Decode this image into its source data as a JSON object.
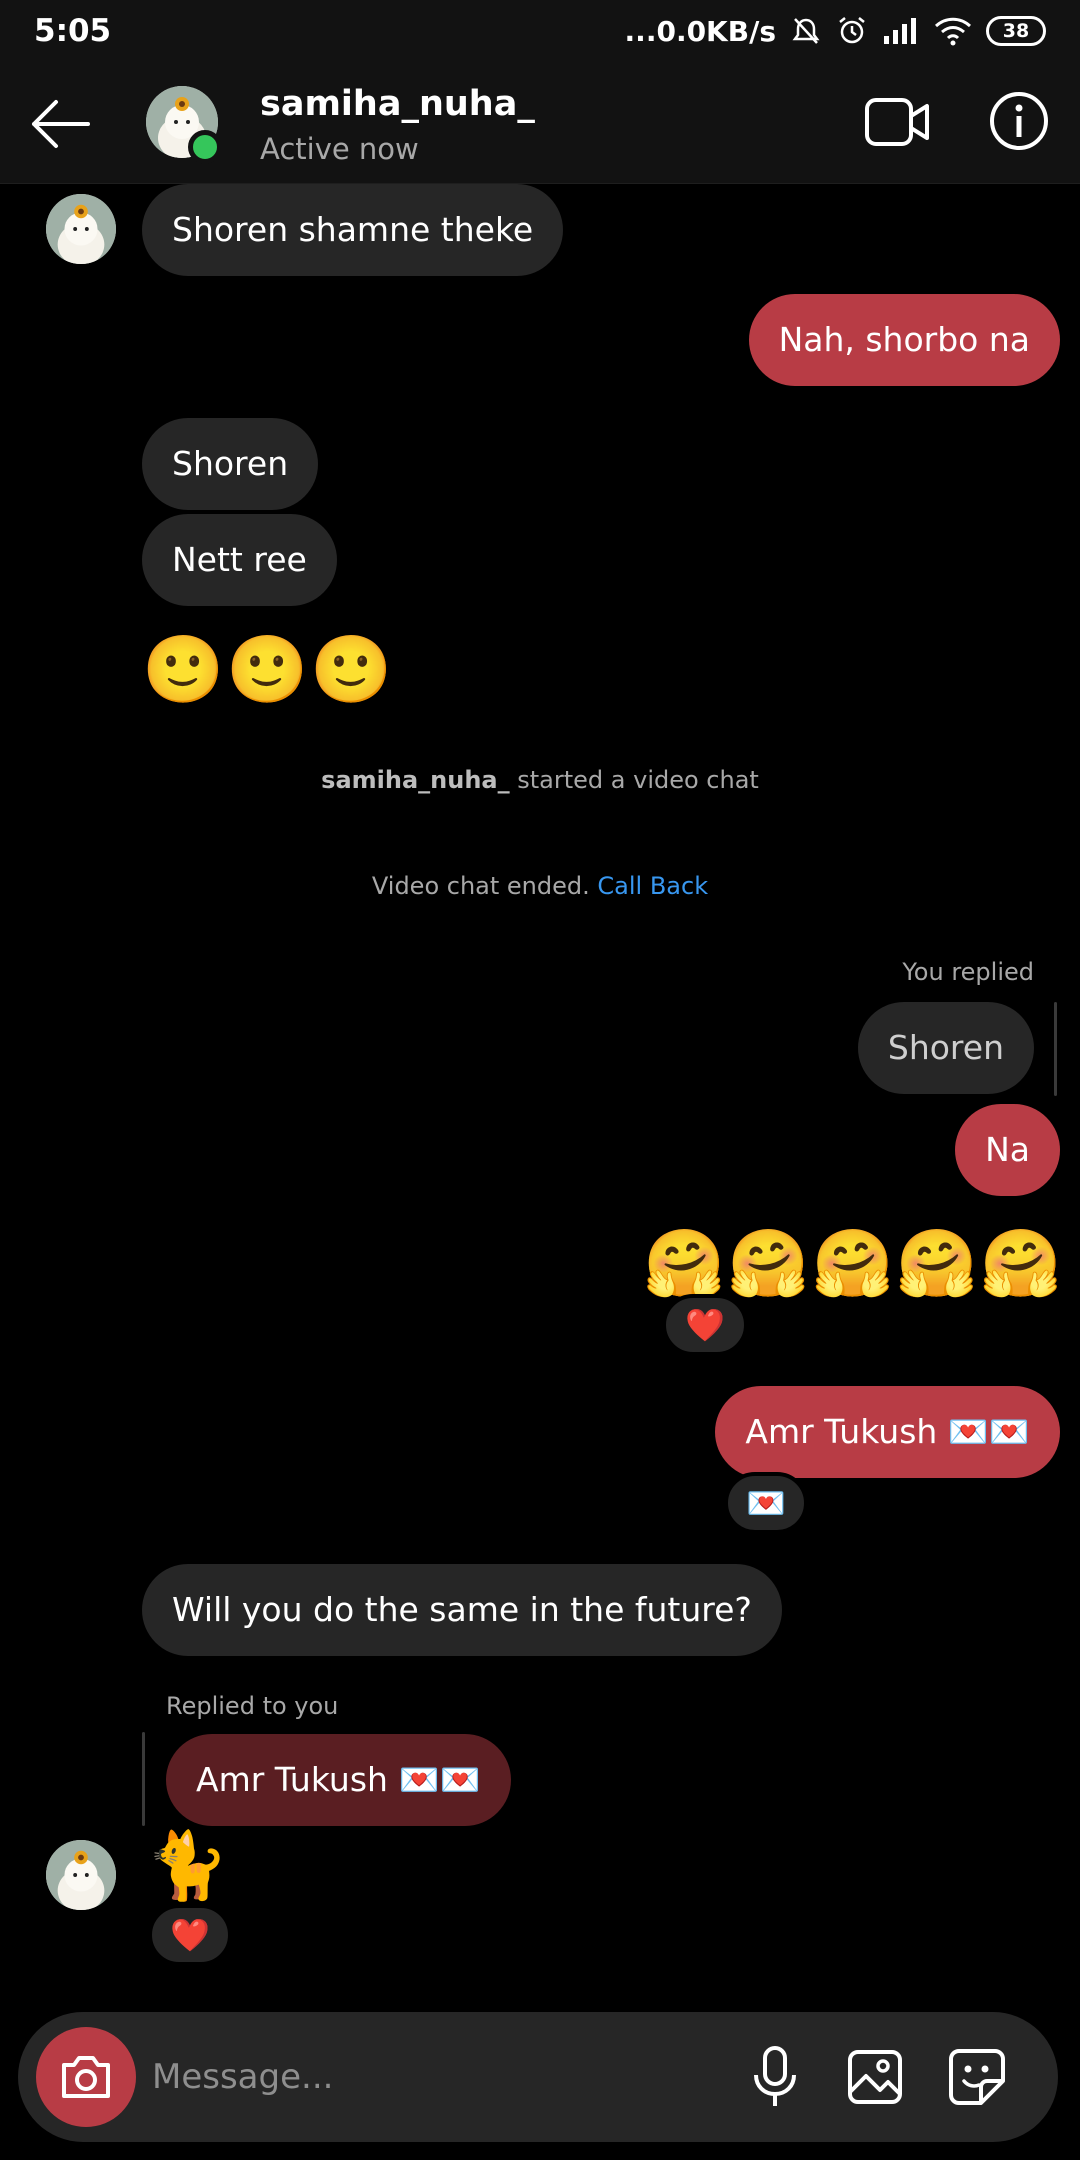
{
  "status_bar": {
    "time": "5:05",
    "network": "...0.0KB/s",
    "battery": "38"
  },
  "header": {
    "name": "samiha_nuha_",
    "status": "Active now"
  },
  "messages": {
    "m1": "Shoren shamne theke",
    "m2": "Nah, shorbo na",
    "m3": "Shoren",
    "m4": "Nett ree",
    "m5_emojis": "🙂🙂🙂",
    "video_started_user": "samiha_nuha_",
    "video_started_text": " started a video chat",
    "video_ended_text": "Video chat ended. ",
    "call_back": "Call Back",
    "you_replied": "You replied",
    "quoted": "Shoren",
    "m6": "Na",
    "m7_emojis": "🤗🤗🤗🤗🤗",
    "m7_reaction": "❤️",
    "m8": "Amr Tukush 💌💌",
    "m8_reaction": "💌",
    "m9": "Will you do the same in the future?",
    "replied_to_you": "Replied to you",
    "quoted2": "Amr Tukush 💌💌",
    "m10_emoji": "🐈",
    "m10_reaction": "❤️"
  },
  "composer": {
    "placeholder": "Message..."
  },
  "colors": {
    "accent": "#b83c45",
    "link": "#3897f0",
    "online": "#35c65b"
  }
}
